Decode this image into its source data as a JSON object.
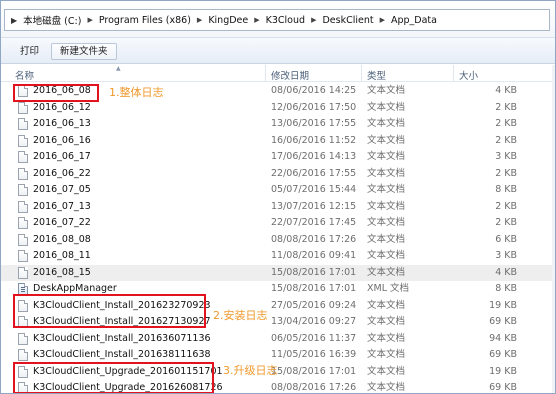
{
  "addressbar": {
    "crumbs": [
      "本地磁盘 (C:)",
      "Program Files (x86)",
      "KingDee",
      "K3Cloud",
      "DeskClient",
      "App_Data"
    ]
  },
  "toolbar": {
    "print_label": "打印",
    "new_folder_label": "新建文件夹"
  },
  "columns": {
    "name": "名称",
    "date": "修改日期",
    "type": "类型",
    "size": "大小"
  },
  "files": [
    {
      "name": "2016_06_08",
      "date": "08/06/2016 14:25",
      "type": "文本文档",
      "size": "4 KB",
      "icon": "text-file-icon"
    },
    {
      "name": "2016_06_12",
      "date": "12/06/2016 17:50",
      "type": "文本文档",
      "size": "2 KB",
      "icon": "text-file-icon"
    },
    {
      "name": "2016_06_13",
      "date": "13/06/2016 17:55",
      "type": "文本文档",
      "size": "2 KB",
      "icon": "text-file-icon"
    },
    {
      "name": "2016_06_16",
      "date": "16/06/2016 11:52",
      "type": "文本文档",
      "size": "2 KB",
      "icon": "text-file-icon"
    },
    {
      "name": "2016_06_17",
      "date": "17/06/2016 14:13",
      "type": "文本文档",
      "size": "3 KB",
      "icon": "text-file-icon"
    },
    {
      "name": "2016_06_22",
      "date": "22/06/2016 17:55",
      "type": "文本文档",
      "size": "2 KB",
      "icon": "text-file-icon"
    },
    {
      "name": "2016_07_05",
      "date": "05/07/2016 15:44",
      "type": "文本文档",
      "size": "8 KB",
      "icon": "text-file-icon"
    },
    {
      "name": "2016_07_13",
      "date": "13/07/2016 12:15",
      "type": "文本文档",
      "size": "2 KB",
      "icon": "text-file-icon"
    },
    {
      "name": "2016_07_22",
      "date": "22/07/2016 17:45",
      "type": "文本文档",
      "size": "2 KB",
      "icon": "text-file-icon"
    },
    {
      "name": "2016_08_08",
      "date": "08/08/2016 17:26",
      "type": "文本文档",
      "size": "6 KB",
      "icon": "text-file-icon"
    },
    {
      "name": "2016_08_11",
      "date": "11/08/2016 09:41",
      "type": "文本文档",
      "size": "3 KB",
      "icon": "text-file-icon"
    },
    {
      "name": "2016_08_15",
      "date": "15/08/2016 17:01",
      "type": "文本文档",
      "size": "4 KB",
      "icon": "text-file-icon"
    },
    {
      "name": "DeskAppManager",
      "date": "15/08/2016 17:01",
      "type": "XML 文档",
      "size": "8 KB",
      "icon": "xml-file-icon"
    },
    {
      "name": "K3CloudClient_Install_201623270923",
      "date": "27/05/2016 09:24",
      "type": "文本文档",
      "size": "19 KB",
      "icon": "text-file-icon"
    },
    {
      "name": "K3CloudClient_Install_201627130927",
      "date": "13/04/2016 09:27",
      "type": "文本文档",
      "size": "69 KB",
      "icon": "text-file-icon"
    },
    {
      "name": "K3CloudClient_Install_201636071136",
      "date": "06/05/2016 11:37",
      "type": "文本文档",
      "size": "94 KB",
      "icon": "text-file-icon"
    },
    {
      "name": "K3CloudClient_Install_201638111638",
      "date": "11/05/2016 16:39",
      "type": "文本文档",
      "size": "69 KB",
      "icon": "text-file-icon"
    },
    {
      "name": "K3CloudClient_Upgrade_201601151701",
      "date": "15/08/2016 17:01",
      "type": "文本文档",
      "size": "19 KB",
      "icon": "text-file-icon"
    },
    {
      "name": "K3CloudClient_Upgrade_201626081726",
      "date": "08/08/2016 17:26",
      "type": "文本文档",
      "size": "69 KB",
      "icon": "text-file-icon"
    }
  ],
  "selected_row": "2016_08_15",
  "annotations": {
    "overall_log": "1.整体日志",
    "install_log": "2.安装日志",
    "upgrade_log": "3.升级日志"
  },
  "colors": {
    "annotation_box": "#e2121e",
    "annotation_text": "#f0992c",
    "selection": "#eeeeee"
  }
}
